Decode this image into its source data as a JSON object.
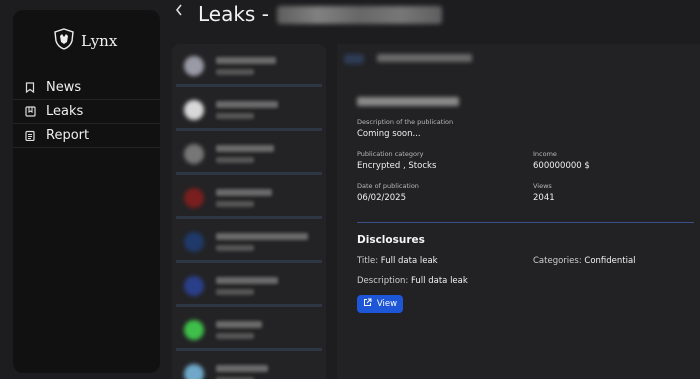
{
  "app": {
    "name": "Lynx"
  },
  "sidebar": {
    "items": [
      {
        "label": "News",
        "icon": "bookmark-icon"
      },
      {
        "label": "Leaks",
        "icon": "bookmarks-icon"
      },
      {
        "label": "Report",
        "icon": "clipboard-icon"
      }
    ]
  },
  "header": {
    "back_icon": "chevron-left-icon",
    "title": "Leaks -"
  },
  "list": {
    "items": [
      {
        "thumb_color": "#9a9aa6",
        "line_width": 60
      },
      {
        "thumb_color": "#d8d8d8",
        "line_width": 62
      },
      {
        "thumb_color": "#777777",
        "line_width": 58
      },
      {
        "thumb_color": "#7a1f1f",
        "line_width": 56
      },
      {
        "thumb_color": "#1f3a6a",
        "line_width": 92
      },
      {
        "thumb_color": "#2a3f8a",
        "line_width": 62
      },
      {
        "thumb_color": "#3fbf4a",
        "line_width": 46
      },
      {
        "thumb_color": "#6fa8c8",
        "line_width": 52
      }
    ]
  },
  "detail": {
    "description_label": "Description of the publication",
    "description_value": "Coming soon...",
    "category_label": "Publication category",
    "category_value": "Encrypted , Stocks",
    "income_label": "Income",
    "income_value": "600000000 $",
    "date_label": "Date of publication",
    "date_value": "06/02/2025",
    "views_label": "Views",
    "views_value": "2041"
  },
  "disclosures": {
    "heading": "Disclosures",
    "title_key": "Title:",
    "title_value": "Full data leak",
    "categories_key": "Categories:",
    "categories_value": "Confidential",
    "description_key": "Description:",
    "description_value": "Full data leak",
    "view_label": "View",
    "view_icon": "external-link-icon"
  },
  "colors": {
    "accent": "#1d57d8",
    "separator": "#3b4f88"
  }
}
